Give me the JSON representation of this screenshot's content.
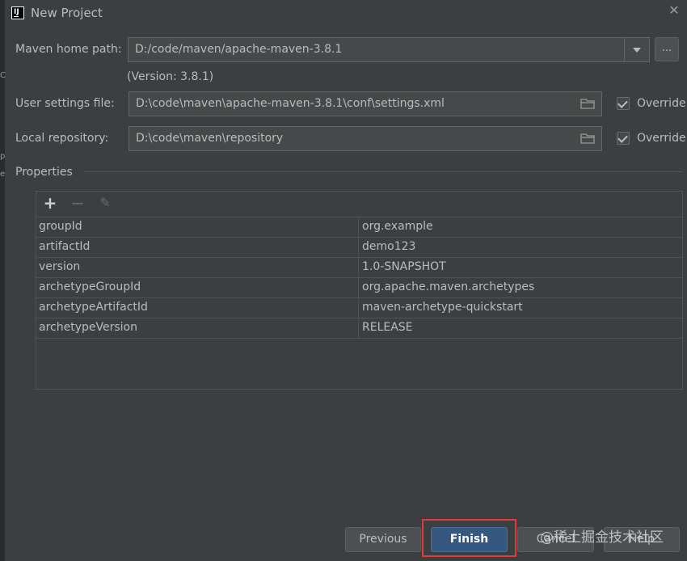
{
  "window": {
    "title": "New Project",
    "icon": "intellij-idea-icon"
  },
  "form": {
    "maven_home": {
      "label": "Maven home path:",
      "value": "D:/code/maven/apache-maven-3.8.1",
      "version_note": "(Version: 3.8.1)",
      "browse_label": "..."
    },
    "user_settings": {
      "label": "User settings file:",
      "value": "D:\\code\\maven\\apache-maven-3.8.1\\conf\\settings.xml",
      "override_label": "Override",
      "override_checked": true
    },
    "local_repo": {
      "label": "Local repository:",
      "value": "D:\\code\\maven\\repository",
      "override_label": "Override",
      "override_checked": true
    }
  },
  "properties": {
    "section_title": "Properties",
    "toolbar": {
      "add": "+",
      "remove": "−",
      "edit": "✎"
    },
    "rows": [
      {
        "key": "groupId",
        "value": "org.example"
      },
      {
        "key": "artifactId",
        "value": "demo123"
      },
      {
        "key": "version",
        "value": "1.0-SNAPSHOT"
      },
      {
        "key": "archetypeGroupId",
        "value": "org.apache.maven.archetypes"
      },
      {
        "key": "archetypeArtifactId",
        "value": "maven-archetype-quickstart"
      },
      {
        "key": "archetypeVersion",
        "value": "RELEASE"
      }
    ]
  },
  "buttons": {
    "previous": "Previous",
    "finish": "Finish",
    "cancel": "Cancel",
    "help": "Help"
  },
  "watermark": "@稀土掘金技术社区",
  "colors": {
    "background": "#3c3f41",
    "field_bg": "#45494a",
    "default_button": "#365880",
    "highlight_box": "#e03a3a",
    "text": "#bbbbbb"
  }
}
